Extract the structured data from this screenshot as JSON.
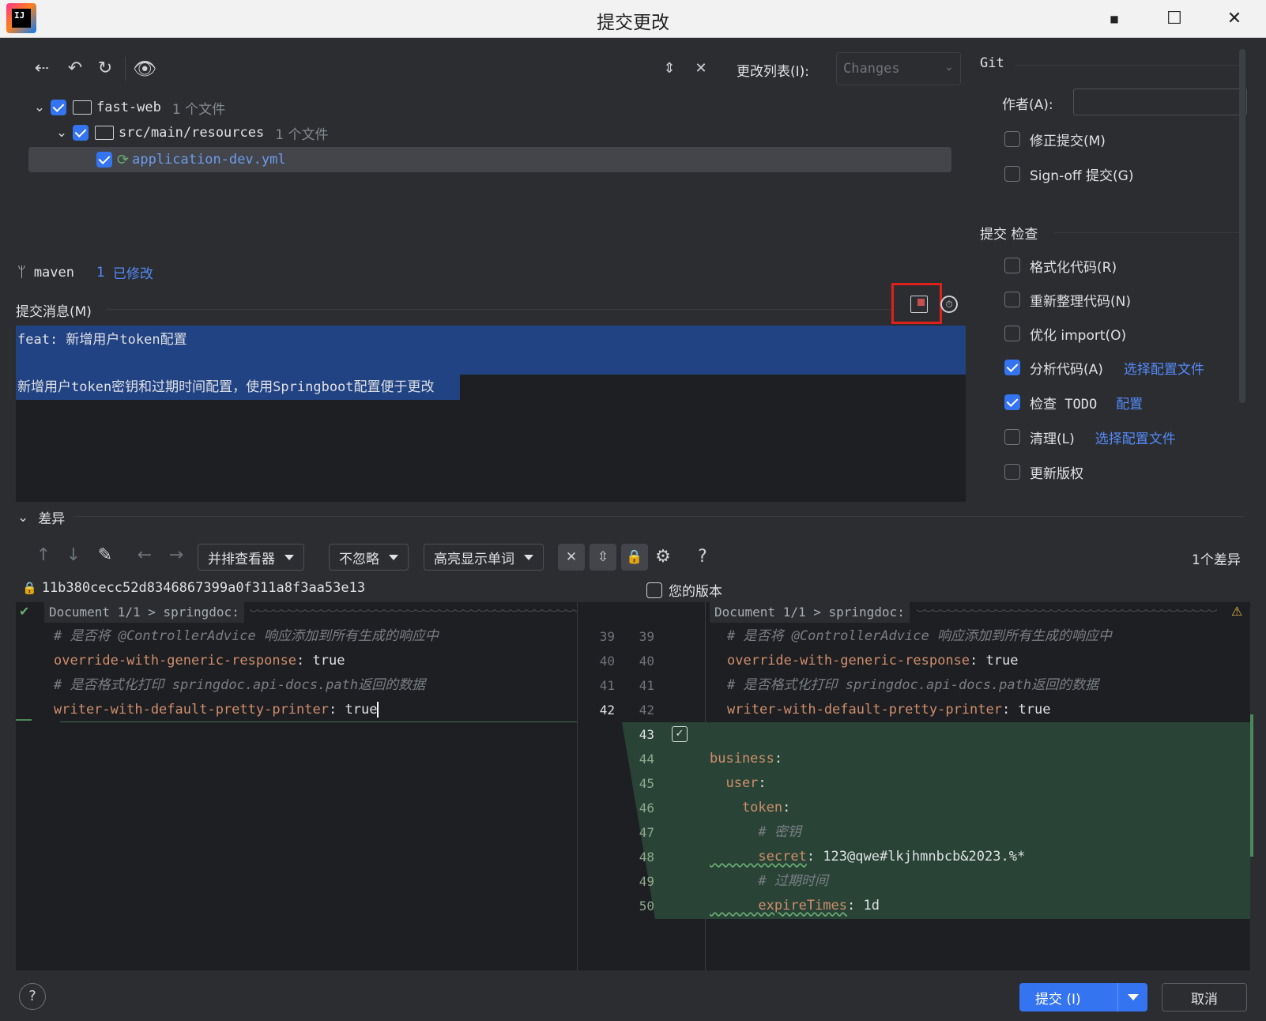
{
  "window": {
    "title": "提交更改",
    "app_logo_text": "IJ"
  },
  "toolbar": {
    "changelist_label": "更改列表(I):",
    "changelist_value": "Changes"
  },
  "tree": {
    "root": {
      "name": "fast-web",
      "count": "1 个文件"
    },
    "folder": {
      "name": "src/main/resources",
      "count": "1 个文件"
    },
    "file": {
      "name": "application-dev.yml"
    }
  },
  "branch": {
    "name": "maven",
    "count": "1",
    "modified_label": "已修改"
  },
  "commit_message": {
    "label": "提交消息(M)",
    "line1": "feat: 新增用户token配置",
    "line3": "新增用户token密钥和过期时间配置，使用Springboot配置便于更改"
  },
  "git_panel": {
    "title": "Git",
    "author_label": "作者(A):",
    "author_value": "",
    "amend_label": "修正提交(M)",
    "signoff_label": "Sign-off 提交(G)"
  },
  "checks_panel": {
    "title": "提交 检查",
    "items": [
      {
        "label": "格式化代码(R)",
        "checked": false,
        "link": ""
      },
      {
        "label": "重新整理代码(N)",
        "checked": false,
        "link": ""
      },
      {
        "label": "优化 import(O)",
        "checked": false,
        "link": ""
      },
      {
        "label": "分析代码(A)",
        "checked": true,
        "link": "选择配置文件"
      },
      {
        "label": "检查 TODO",
        "checked": true,
        "link": "配置"
      },
      {
        "label": "清理(L)",
        "checked": false,
        "link": "选择配置文件"
      },
      {
        "label": "更新版权",
        "checked": false,
        "link": ""
      }
    ]
  },
  "diff": {
    "section_label": "差异",
    "viewer_mode": "并排查看器",
    "ignore_mode": "不忽略",
    "highlight_mode": "高亮显示单词",
    "diff_count": "1个差异",
    "left_revision": "11b380cecc52d8346867399a0f311a8f3aa53e13",
    "right_revision": "您的版本",
    "breadcrumb": "Document 1/1 > springdoc:",
    "left_lines": [
      {
        "no": "39",
        "comment": "# 是否将 @ControllerAdvice 响应添加到所有生成的响应中"
      },
      {
        "no": "40",
        "key": "override-with-generic-response",
        "sep": ": ",
        "val": "true"
      },
      {
        "no": "41",
        "comment": "# 是否格式化打印 springdoc.api-docs.path返回的数据"
      },
      {
        "no": "42",
        "key": "writer-with-default-pretty-printer",
        "sep": ": ",
        "val": "true"
      }
    ],
    "right_lines": [
      {
        "no": "39",
        "comment": "# 是否将 @ControllerAdvice 响应添加到所有生成的响应中"
      },
      {
        "no": "40",
        "key": "override-with-generic-response",
        "sep": ": ",
        "val": "true"
      },
      {
        "no": "41",
        "comment": "# 是否格式化打印 springdoc.api-docs.path返回的数据"
      },
      {
        "no": "42",
        "key": "writer-with-default-pretty-printer",
        "sep": ": ",
        "val": "true"
      },
      {
        "no": "43",
        "text": ""
      },
      {
        "no": "44",
        "key": "business",
        "sep": ":",
        "val": ""
      },
      {
        "no": "45",
        "key": "  user",
        "sep": ":",
        "val": ""
      },
      {
        "no": "46",
        "key": "    token",
        "sep": ":",
        "val": ""
      },
      {
        "no": "47",
        "comment": "      # 密钥"
      },
      {
        "no": "48",
        "key": "      secret",
        "sep": ": ",
        "val": "123@qwe#lkjhmnbcb&2023.%*"
      },
      {
        "no": "49",
        "comment": "      # 过期时间"
      },
      {
        "no": "50",
        "key": "      expireTimes",
        "sep": ": ",
        "val": "1d"
      }
    ]
  },
  "footer": {
    "help": "?",
    "commit_label": "提交 (I)",
    "cancel_label": "取消"
  },
  "colors": {
    "accent": "#3574f0",
    "selection": "#214283",
    "added_bg": "#294436",
    "highlight_box": "#e0201b"
  }
}
